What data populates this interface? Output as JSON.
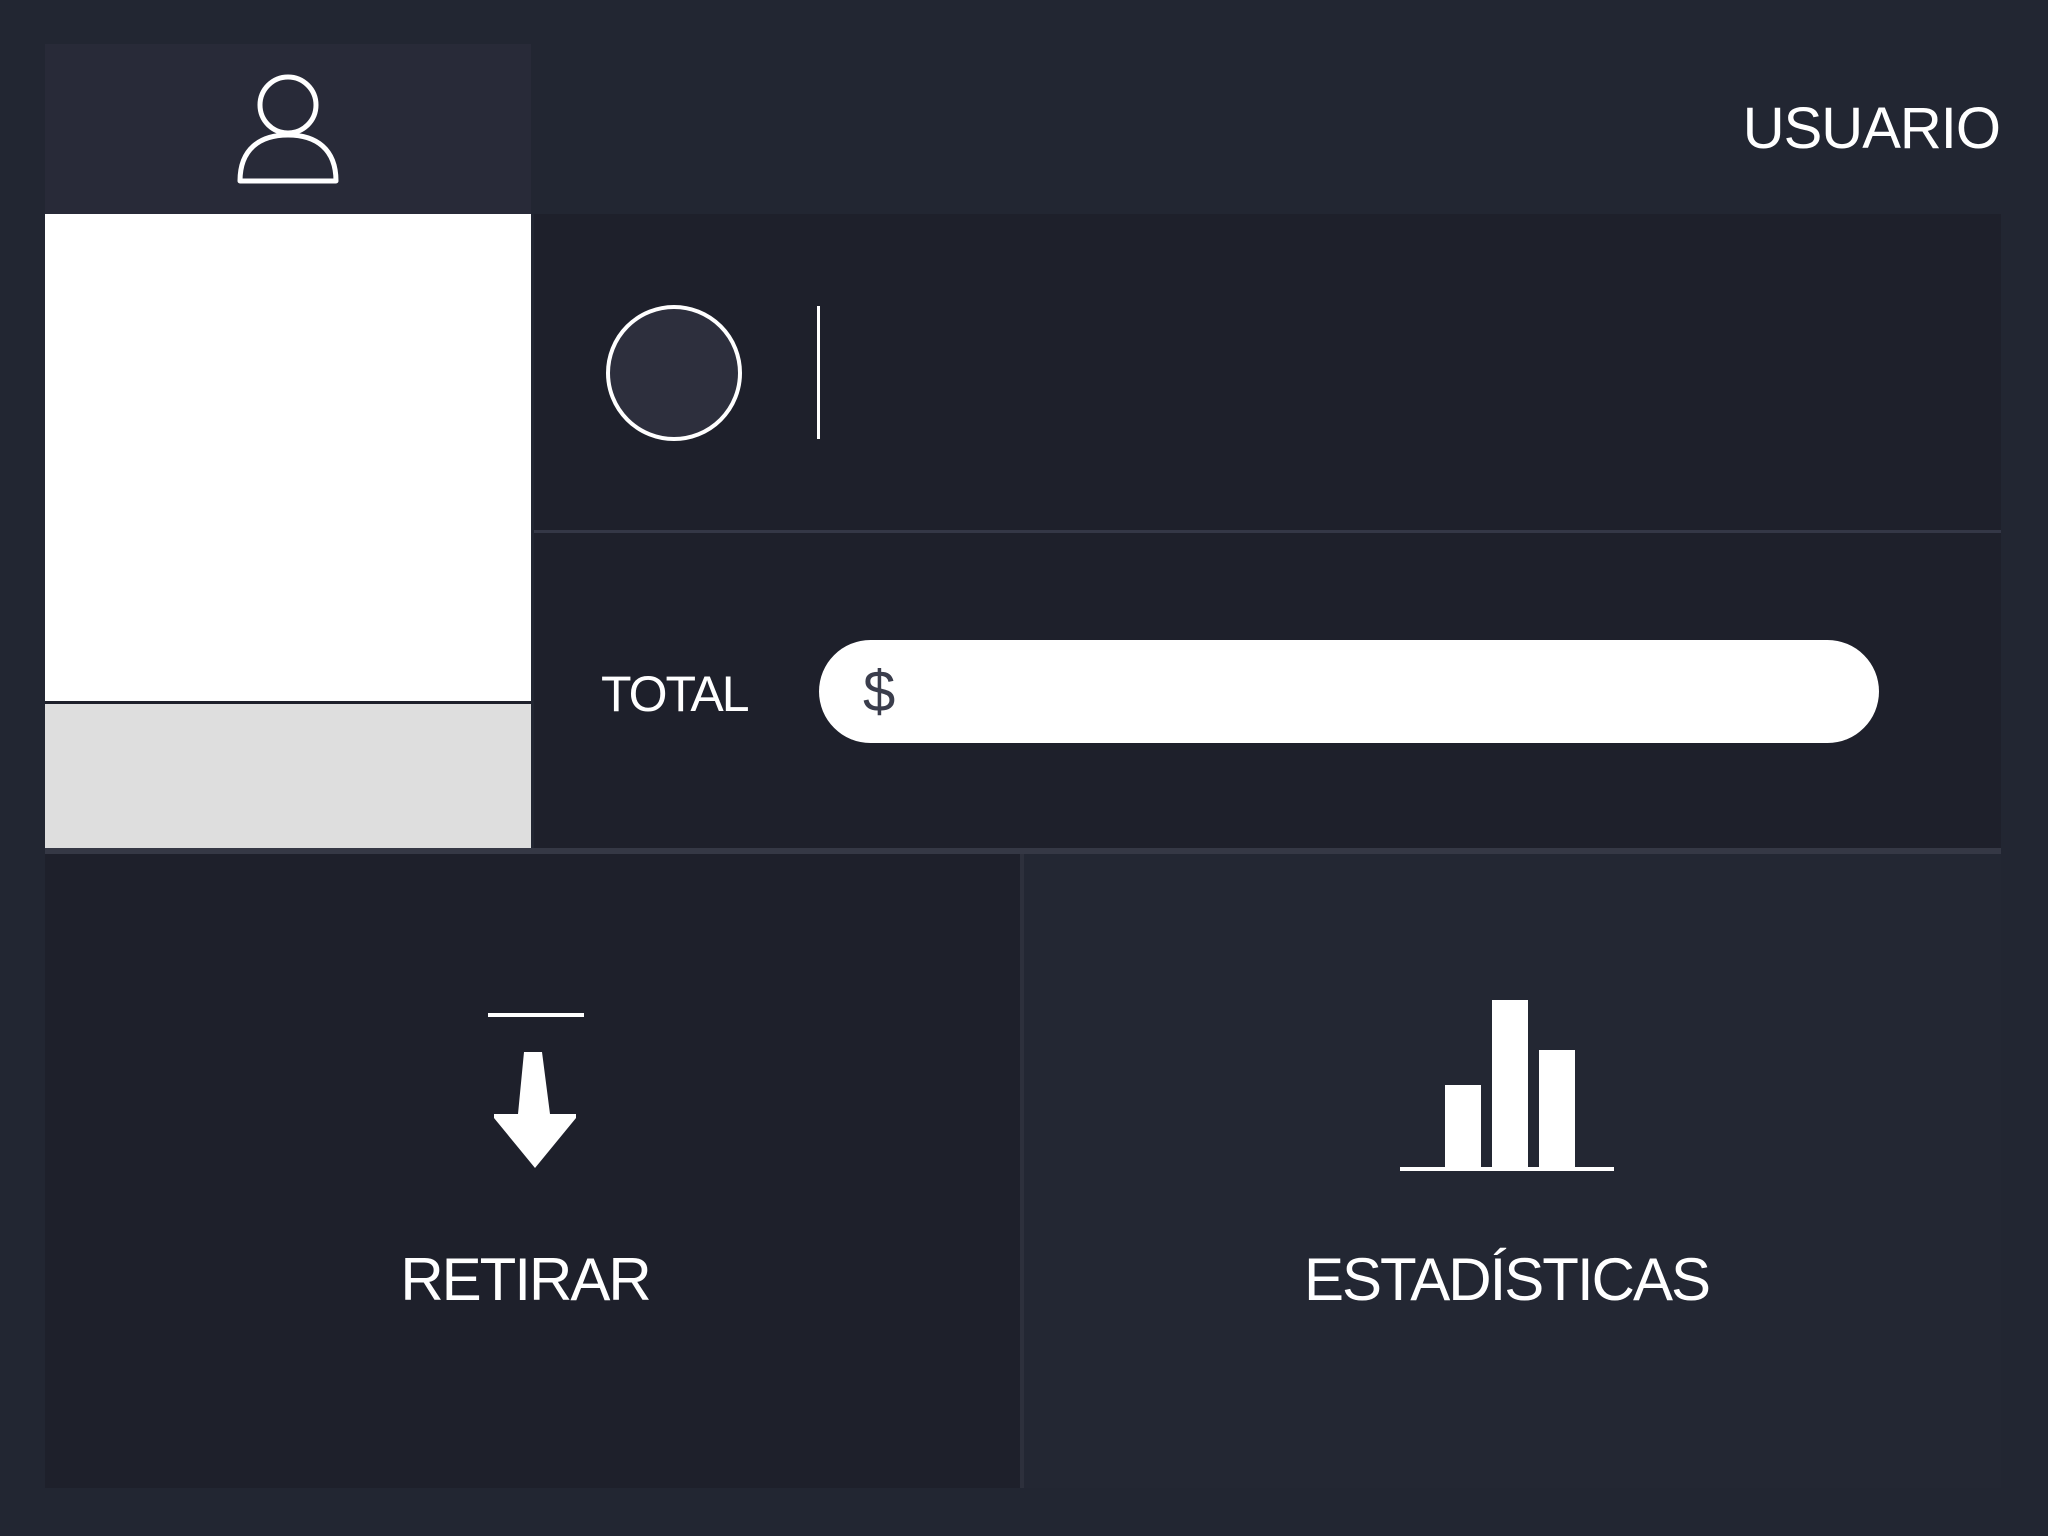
{
  "header": {
    "title": "USUARIO",
    "user_icon": "user-icon"
  },
  "account": {
    "avatar_icon": "avatar-circle",
    "name_value": "",
    "total_label": "TOTAL",
    "total_currency": "$",
    "total_value": ""
  },
  "actions": {
    "withdraw": {
      "label": "RETIRAR",
      "icon": "download-arrow-icon"
    },
    "stats": {
      "label": "ESTADÍSTICAS",
      "icon": "bar-chart-icon"
    }
  },
  "colors": {
    "background": "#222632",
    "panel_dark": "#1e202b",
    "header_cell": "#282a38",
    "white": "#ffffff",
    "photo_footer": "#dedede"
  }
}
